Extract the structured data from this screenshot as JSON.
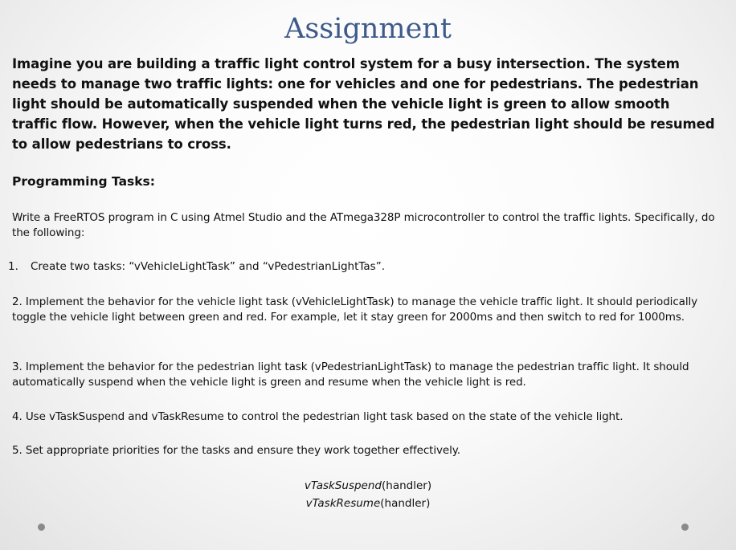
{
  "slide": {
    "title": "Assignment",
    "intro": "Imagine you are building a traffic light control system for a busy intersection. The system needs to manage two traffic lights: one for vehicles and one for pedestrians. The pedestrian light should be automatically suspended when the vehicle light is green to allow smooth traffic flow. However, when the vehicle light turns red, the pedestrian light should be resumed to allow pedestrians to cross.",
    "section_heading": "Programming Tasks:",
    "task_intro": "Write a FreeRTOS program in C using Atmel Studio and the ATmega328P microcontroller to control the traffic lights. Specifically, do the following:",
    "task1_number": "1.",
    "task1_text": "Create two tasks: “vVehicleLightTask” and “vPedestrianLightTas”.",
    "task2": "2. Implement the behavior for the vehicle light task (vVehicleLightTask) to manage the vehicle traffic light. It should periodically toggle the vehicle light between green and red. For example, let it stay green for 2000ms and then switch to red for 1000ms.",
    "task3": "3. Implement the behavior for the pedestrian light task (vPedestrianLightTask) to manage the pedestrian traffic light. It should automatically suspend when the vehicle light is green and resume when the vehicle light is red.",
    "task4": "4. Use vTaskSuspend and vTaskResume to control the pedestrian light task based on the state of the vehicle light.",
    "task5": "5. Set appropriate priorities for the tasks and ensure they work together effectively.",
    "code1_func": "vTaskSuspend",
    "code1_arg": "(handler)",
    "code2_func": "vTaskResume",
    "code2_arg": "(handler)"
  },
  "colors": {
    "title": "#3d5a8a",
    "text": "#111111",
    "dots": "#8a8a8a"
  }
}
